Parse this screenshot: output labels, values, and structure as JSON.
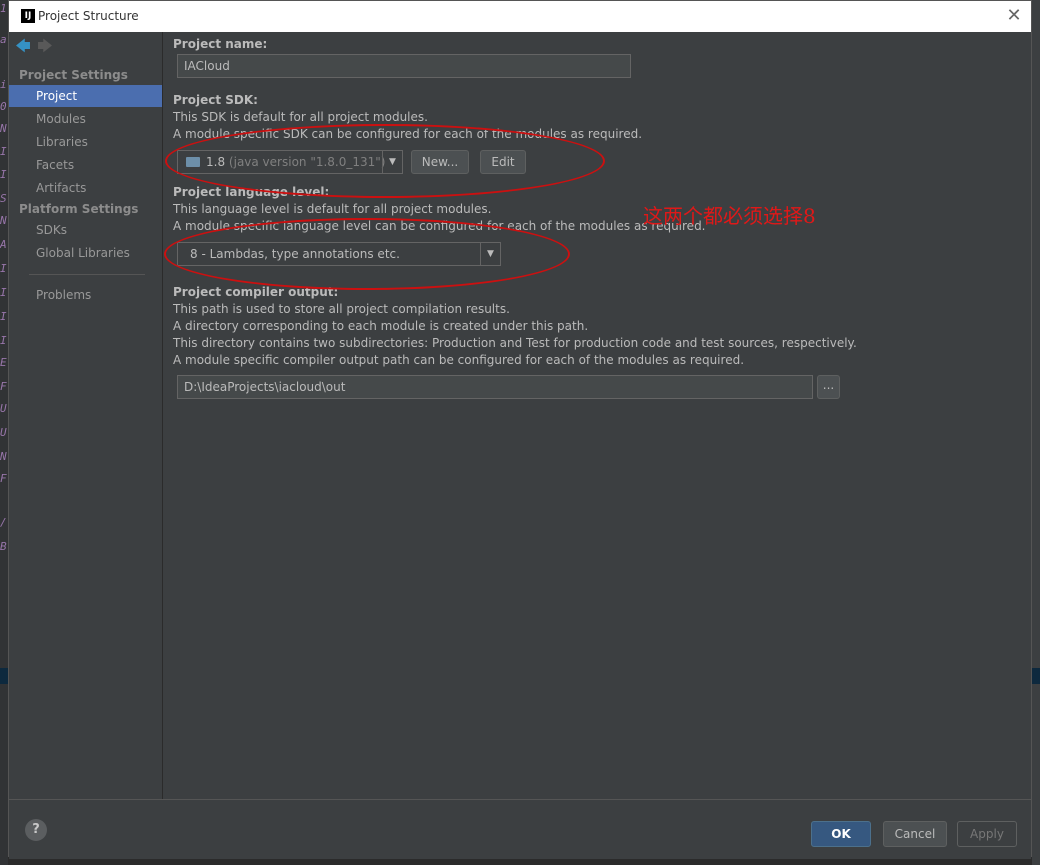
{
  "window": {
    "title": "Project Structure",
    "app_icon": "IJ",
    "close_symbol": "✕"
  },
  "sidebar": {
    "project_settings_header": "Project Settings",
    "project_items": [
      "Project",
      "Modules",
      "Libraries",
      "Facets",
      "Artifacts"
    ],
    "platform_settings_header": "Platform Settings",
    "platform_items": [
      "SDKs",
      "Global Libraries"
    ],
    "other_items": [
      "Problems"
    ],
    "selected": "Project"
  },
  "main": {
    "project_name": {
      "label": "Project name:",
      "value": "IACloud"
    },
    "project_sdk": {
      "label": "Project SDK:",
      "desc1": "This SDK is default for all project modules.",
      "desc2": "A module specific SDK can be configured for each of the modules as required.",
      "selected_version": "1.8",
      "selected_detail": "(java version \"1.8.0_131\")",
      "new_button": "New...",
      "edit_button": "Edit"
    },
    "language_level": {
      "label": "Project language level:",
      "desc1": "This language level is default for all project modules.",
      "desc2": "A module specific language level can be configured for each of the modules as required.",
      "selected": "8 - Lambdas, type annotations etc."
    },
    "compiler_output": {
      "label": "Project compiler output:",
      "desc1": "This path is used to store all project compilation results.",
      "desc2": "A directory corresponding to each module is created under this path.",
      "desc3": "This directory contains two subdirectories: Production and Test for production code and test sources, respectively.",
      "desc4": "A module specific compiler output path can be configured for each of the modules as required.",
      "path": "D:\\IdeaProjects\\iacloud\\out",
      "browse_button": "..."
    }
  },
  "annotation": {
    "text": "这两个都必须选择8",
    "color": "#cc1010"
  },
  "footer": {
    "help": "?",
    "ok": "OK",
    "cancel": "Cancel",
    "apply": "Apply"
  },
  "background_gutter": [
    "1",
    "a",
    "i",
    "0",
    "N",
    "I",
    "I",
    "S",
    "N",
    "A",
    "I",
    "I",
    "I",
    "I",
    "E",
    "F",
    "U",
    "U",
    "N",
    "F",
    "/",
    "B"
  ],
  "colors": {
    "selection": "#4b6eaf",
    "dialog_bg": "#3c3f41",
    "ok_button": "#365880"
  }
}
